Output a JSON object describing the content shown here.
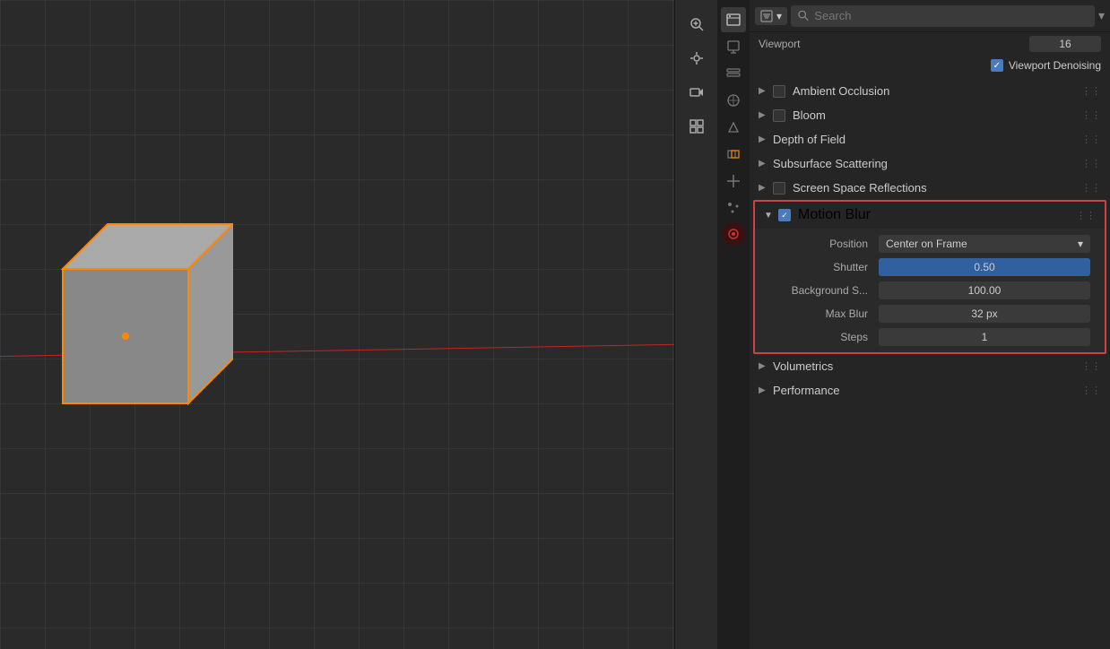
{
  "viewport": {
    "label": "Viewport"
  },
  "header": {
    "search_placeholder": "Search",
    "dropdown_label": "▾"
  },
  "properties": {
    "viewport_label": "Viewport",
    "viewport_value": "16",
    "denoising_label": "Viewport Denoising",
    "sections": [
      {
        "id": "ambient-occlusion",
        "name": "Ambient Occlusion",
        "arrow": "▶",
        "has_checkbox": true,
        "checked": false,
        "open": false
      },
      {
        "id": "bloom",
        "name": "Bloom",
        "arrow": "▶",
        "has_checkbox": true,
        "checked": false,
        "open": false
      },
      {
        "id": "depth-of-field",
        "name": "Depth of Field",
        "arrow": "▶",
        "has_checkbox": false,
        "checked": false,
        "open": false
      },
      {
        "id": "subsurface-scattering",
        "name": "Subsurface Scattering",
        "arrow": "▶",
        "has_checkbox": false,
        "checked": false,
        "open": false
      },
      {
        "id": "screen-space-reflections",
        "name": "Screen Space Reflections",
        "arrow": "▶",
        "has_checkbox": true,
        "checked": false,
        "open": false
      },
      {
        "id": "motion-blur",
        "name": "Motion Blur",
        "arrow": "▼",
        "has_checkbox": true,
        "checked": true,
        "open": true
      }
    ],
    "motion_blur": {
      "position_label": "Position",
      "position_value": "Center on Frame",
      "shutter_label": "Shutter",
      "shutter_value": "0.50",
      "bg_scale_label": "Background S...",
      "bg_scale_value": "100.00",
      "max_blur_label": "Max Blur",
      "max_blur_value": "32 px",
      "steps_label": "Steps",
      "steps_value": "1"
    },
    "bottom_sections": [
      {
        "id": "volumetrics",
        "name": "Volumetrics",
        "arrow": "▶"
      },
      {
        "id": "performance",
        "name": "Performance",
        "arrow": "▶"
      }
    ]
  },
  "side_icons": [
    {
      "id": "render",
      "icon": "📷",
      "active": true
    },
    {
      "id": "output",
      "icon": "🖨",
      "active": false
    },
    {
      "id": "view-layer",
      "icon": "🖼",
      "active": false
    },
    {
      "id": "scene",
      "icon": "🎬",
      "active": false
    },
    {
      "id": "world",
      "icon": "🌐",
      "active": false
    },
    {
      "id": "object",
      "icon": "🔺",
      "active": false
    },
    {
      "id": "modifier",
      "icon": "🔧",
      "active": false
    },
    {
      "id": "particles",
      "icon": "✨",
      "active": false
    },
    {
      "id": "physics",
      "icon": "⚛",
      "active": false
    }
  ],
  "toolbar_icons": [
    {
      "id": "zoom-in",
      "icon": "🔍"
    },
    {
      "id": "pan",
      "icon": "✋"
    },
    {
      "id": "camera",
      "icon": "🎥"
    },
    {
      "id": "grid",
      "icon": "⊞"
    }
  ]
}
